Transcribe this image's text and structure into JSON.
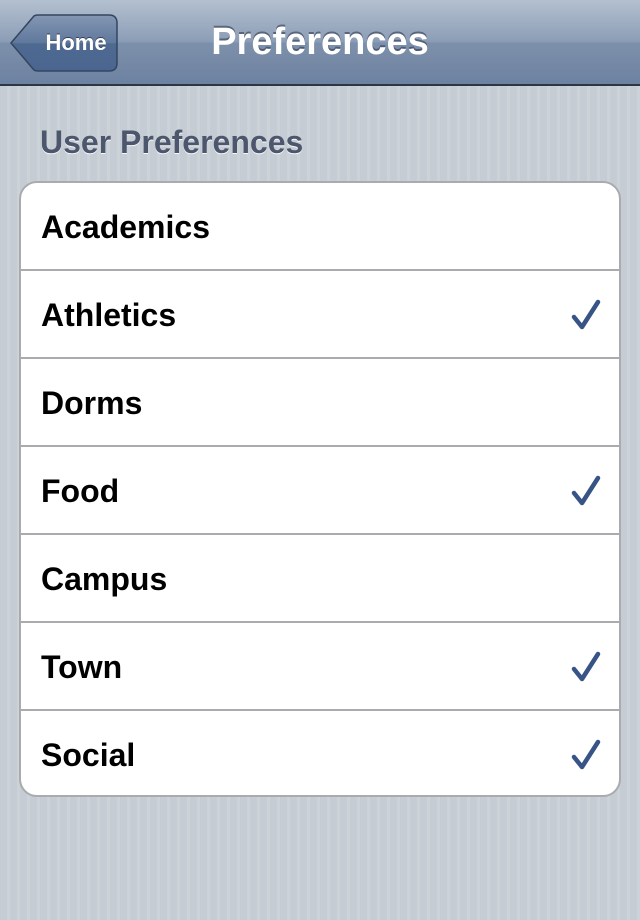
{
  "navbar": {
    "back_label": "Home",
    "title": "Preferences"
  },
  "section": {
    "header": "User Preferences"
  },
  "colors": {
    "checkmark": "#385487",
    "background": "#c5ccd4"
  },
  "items": [
    {
      "label": "Academics",
      "checked": false
    },
    {
      "label": "Athletics",
      "checked": true
    },
    {
      "label": "Dorms",
      "checked": false
    },
    {
      "label": "Food",
      "checked": true
    },
    {
      "label": "Campus",
      "checked": false
    },
    {
      "label": "Town",
      "checked": true
    },
    {
      "label": "Social",
      "checked": true
    }
  ]
}
